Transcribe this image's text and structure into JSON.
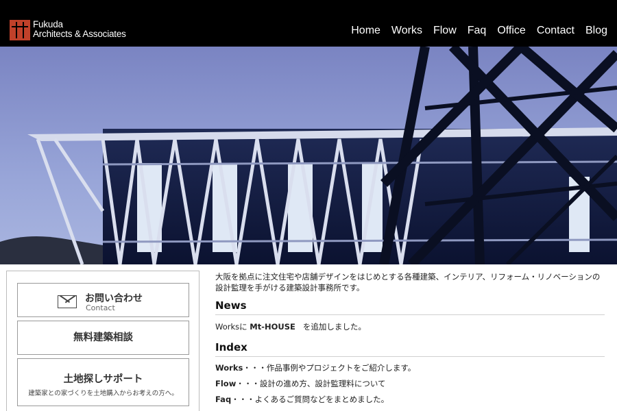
{
  "header": {
    "logo_line1": "Fukuda",
    "logo_line2": "Architects & Associates",
    "nav": [
      "Home",
      "Works",
      "Flow",
      "Faq",
      "Office",
      "Contact",
      "Blog"
    ]
  },
  "sidebar": {
    "contact_jp": "お問い合わせ",
    "contact_en": "Contact",
    "consult": "無料建築相談",
    "land_title": "土地探しサポート",
    "land_sub": "建築家との家づくりを土地購入からお考えの方へ。"
  },
  "main": {
    "intro": "大阪を拠点に注文住宅や店舗デザインをはじめとする各種建築、インテリア、リフォーム・リノベーションの設計監理を手がける建築設計事務所です。",
    "news_heading": "News",
    "news_pre": "Worksに",
    "news_link": "Mt-HOUSE",
    "news_post": "を追加しました。",
    "index_heading": "Index",
    "index_items": [
      {
        "label": "Works",
        "desc": "・・・作品事例やプロジェクトをご紹介します。"
      },
      {
        "label": "Flow",
        "desc": "・・・設計の進め方、設計監理料について"
      },
      {
        "label": "Faq",
        "desc": "・・・よくあるご質問などをまとめました。"
      }
    ]
  },
  "colors": {
    "header_bg": "#000000",
    "logo_red": "#c0412a",
    "sky_top": "#7d87c4",
    "sky_bottom": "#a6b3dd"
  },
  "icons": {
    "mail": "mail-icon"
  }
}
